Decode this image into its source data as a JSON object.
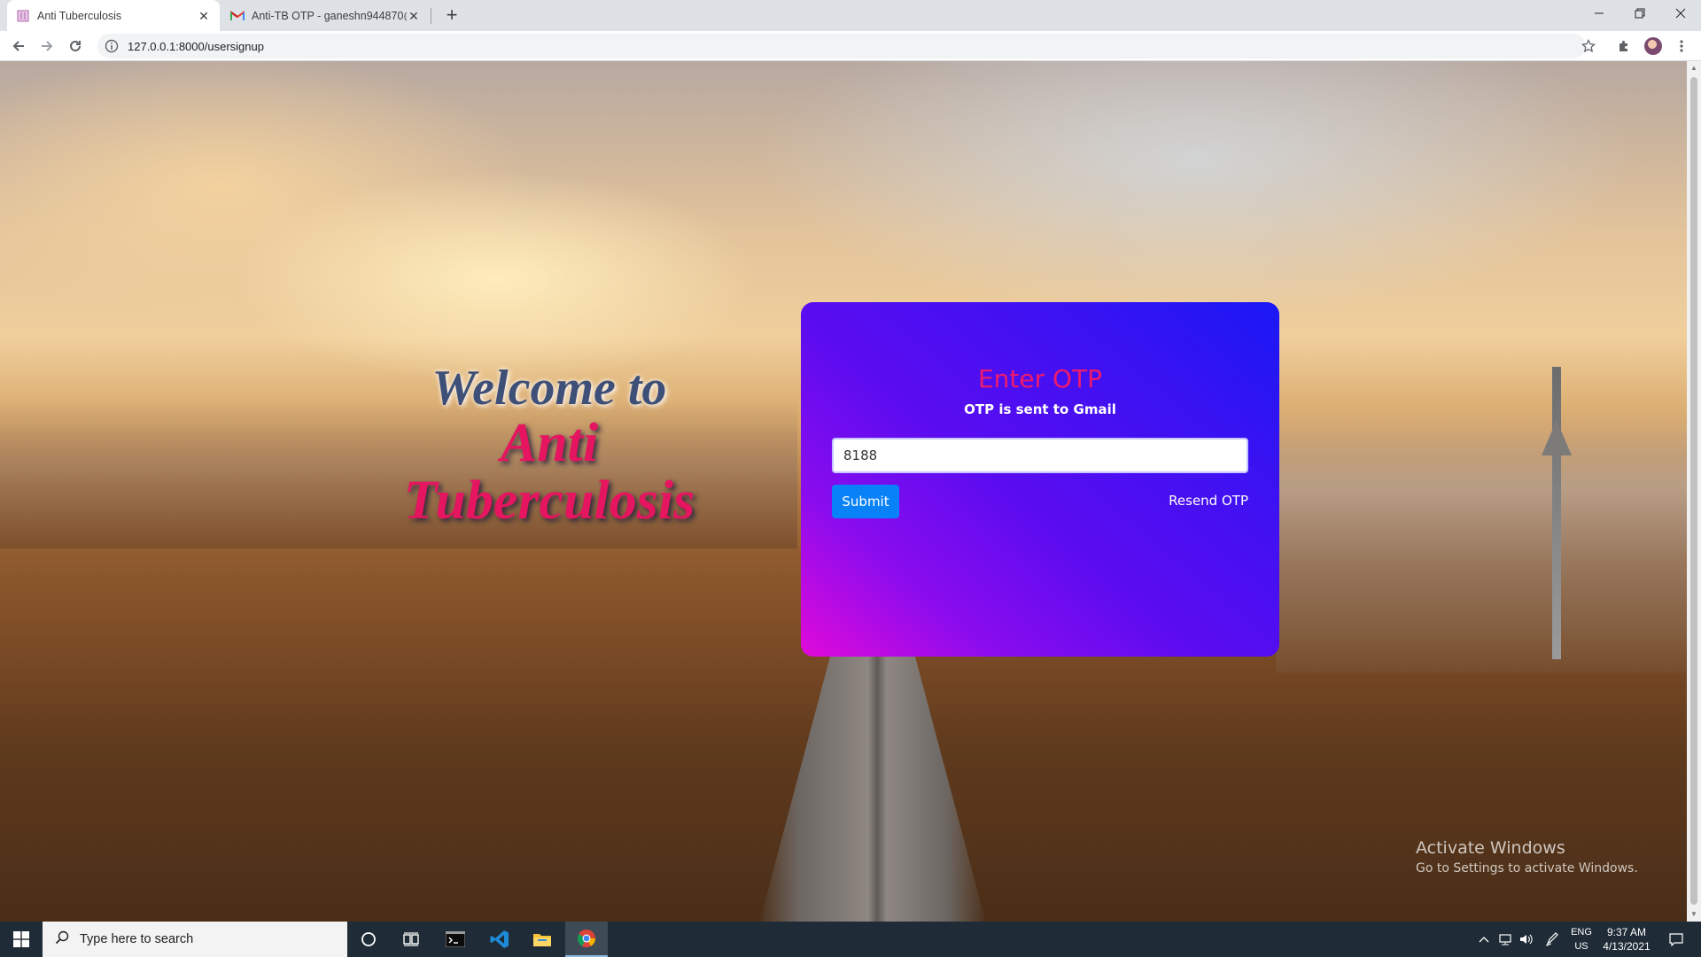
{
  "browser": {
    "tabs": [
      {
        "title": "Anti Tuberculosis",
        "active": true
      },
      {
        "title": "Anti-TB OTP - ganeshn944870@",
        "active": false
      }
    ],
    "new_tab_symbol": "+",
    "url": "127.0.0.1:8000/usersignup"
  },
  "page": {
    "welcome_line1": "Welcome to",
    "welcome_line2": "Anti",
    "welcome_line3": "Tuberculosis",
    "card": {
      "title": "Enter OTP",
      "subtitle": "OTP is sent to Gmail",
      "otp_value": "8188",
      "submit_label": "Submit",
      "resend_label": "Resend OTP"
    },
    "watermark": {
      "line1": "Activate Windows",
      "line2": "Go to Settings to activate Windows."
    }
  },
  "taskbar": {
    "search_placeholder": "Type here to search",
    "language": "ENG",
    "region": "US",
    "time": "9:37 AM",
    "date": "4/13/2021",
    "apps": [
      "cortana-icon",
      "task-view-icon",
      "terminal-icon",
      "vscode-icon",
      "file-explorer-icon",
      "chrome-icon"
    ]
  },
  "colors": {
    "card_gradient_start": "#e10ad9",
    "card_gradient_end": "#1a18f5",
    "title_pink": "#f01a6a",
    "submit_blue": "#0a82f7"
  }
}
